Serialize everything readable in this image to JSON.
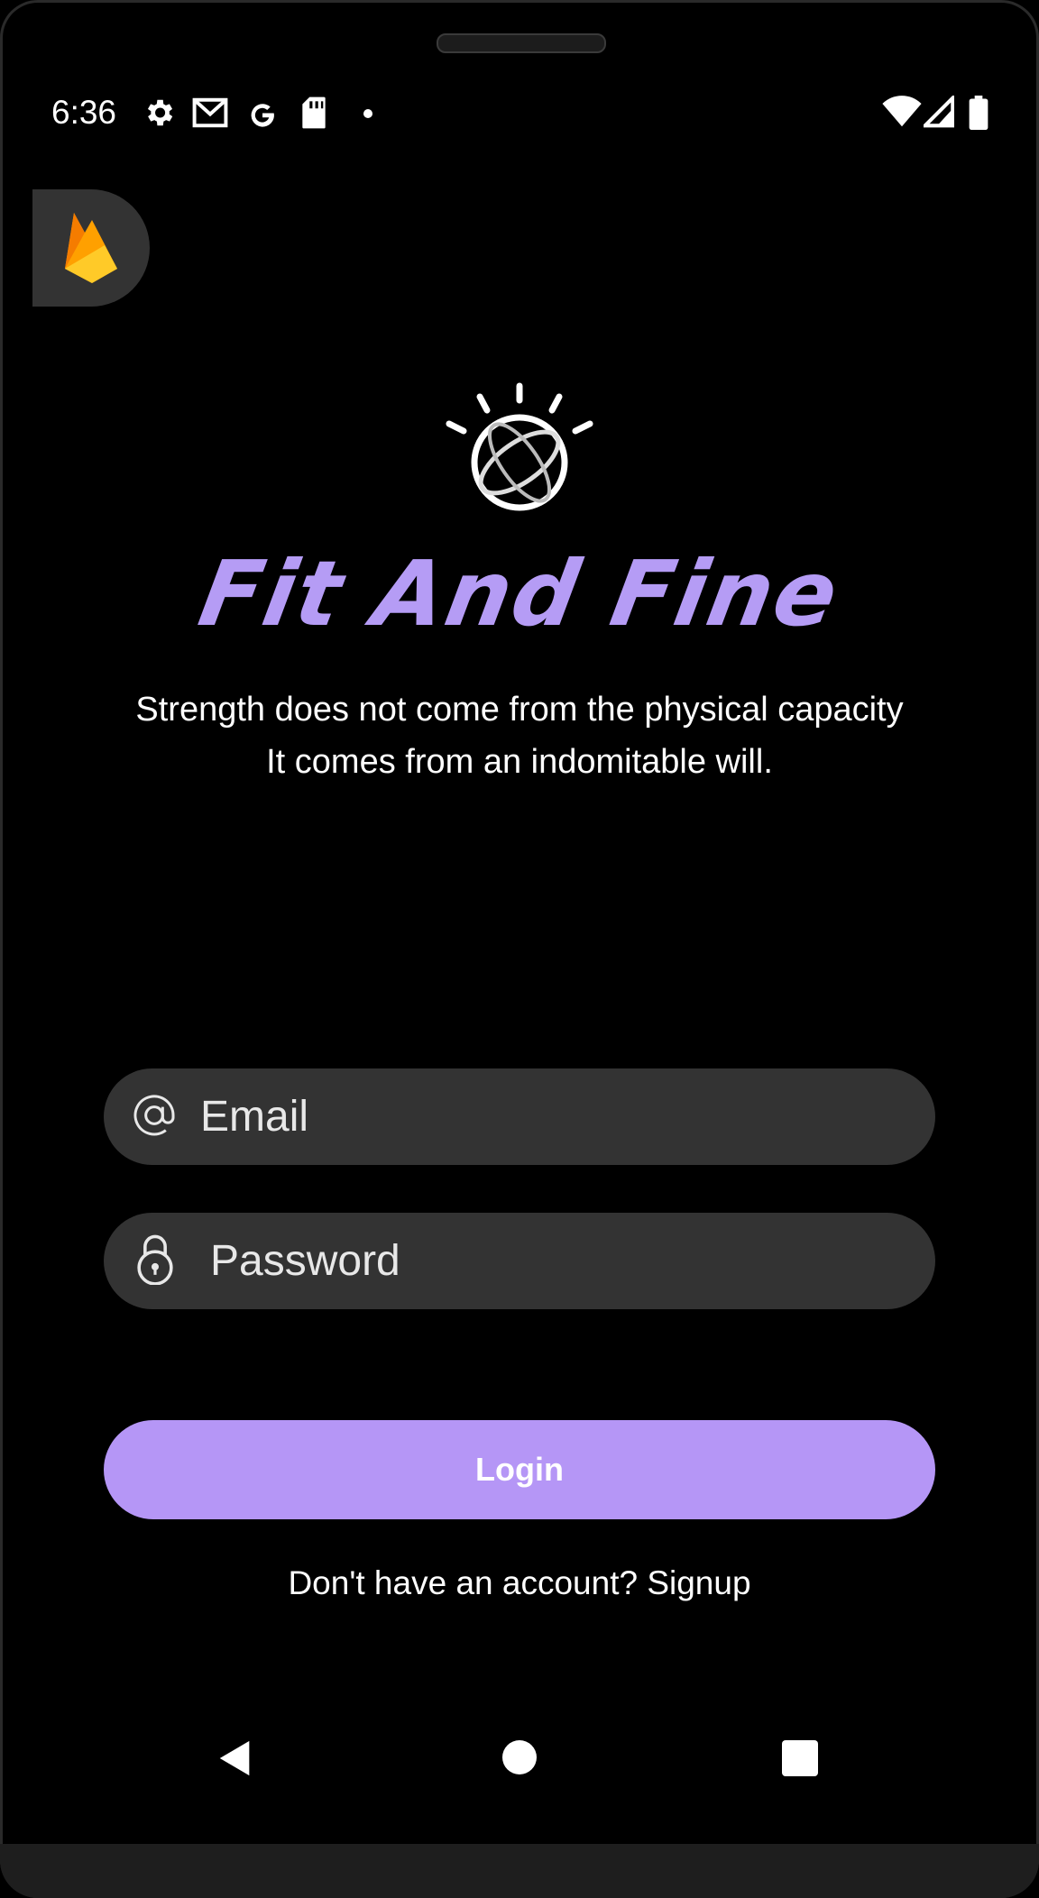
{
  "status_bar": {
    "time": "6:36",
    "icons": [
      "settings-icon",
      "gmail-icon",
      "google-icon",
      "sd-card-icon",
      "dot-icon",
      "wifi-icon",
      "signal-icon",
      "battery-icon"
    ]
  },
  "app": {
    "title": "Fit And Fine",
    "quote_line1": "Strength does not come from the physical capacity",
    "quote_line2": "It comes from an indomitable will.",
    "accent_color": "#b596f6"
  },
  "form": {
    "email_placeholder": "Email",
    "password_placeholder": "Password",
    "login_label": "Login",
    "signup_text": "Don't have an account? Signup"
  },
  "nav_bar": {
    "buttons": [
      "back-icon",
      "home-icon",
      "recents-icon"
    ]
  }
}
